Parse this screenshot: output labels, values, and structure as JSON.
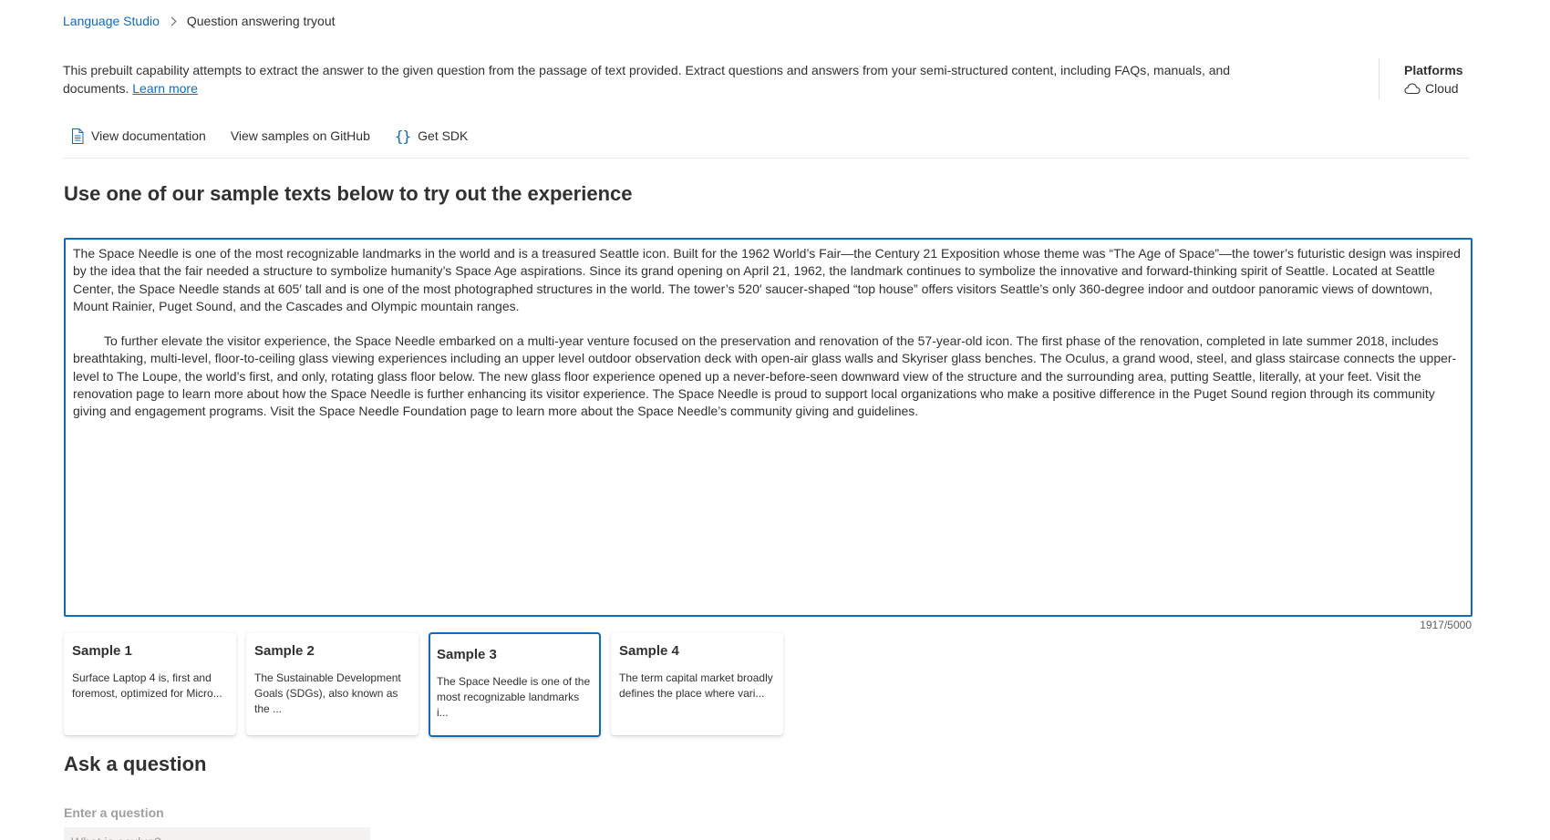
{
  "breadcrumb": {
    "root": "Language Studio",
    "current": "Question answering tryout"
  },
  "description": {
    "text": "This prebuilt capability attempts to extract the answer to the given question from the passage of text provided. Extract questions and answers from your semi-structured content, including FAQs, manuals, and documents.",
    "learn_more": "Learn more"
  },
  "platforms": {
    "title": "Platforms",
    "value": "Cloud",
    "icon": "cloud-icon"
  },
  "links": {
    "documentation": "View documentation",
    "github": "View samples on GitHub",
    "sdk": "Get SDK",
    "documentation_icon": "document-icon",
    "sdk_icon": "code-braces-icon"
  },
  "sample_section": {
    "title": "Use one of our sample texts below to try out the experience"
  },
  "passage": {
    "paragraph1": "The Space Needle is one of the most recognizable landmarks in the world and is a treasured Seattle icon. Built for the 1962 World’s Fair—the Century 21 Exposition whose theme was “The Age of Space”—the tower’s futuristic design was inspired by the idea that the fair needed a structure to symbolize humanity’s Space Age aspirations. Since its grand opening on April 21, 1962, the landmark continues to symbolize the innovative and forward-thinking spirit of Seattle. Located at Seattle Center, the Space Needle stands at 605′ tall and is one of the most photographed structures in the world. The tower’s 520′ saucer-shaped “top house” offers visitors Seattle’s only 360-degree indoor and outdoor panoramic views of downtown, Mount Rainier, Puget Sound, and the Cascades and Olympic mountain ranges.",
    "paragraph2": "To further elevate the visitor experience, the Space Needle embarked on a multi-year venture focused on the preservation and renovation of the 57-year-old icon. The first phase of the renovation, completed in late summer 2018, includes breathtaking, multi-level, floor-to-ceiling glass viewing experiences including an upper level outdoor observation deck with open-air glass walls and Skyriser glass benches. The Oculus, a grand wood, steel, and glass staircase connects the upper-level to The Loupe, the world’s first, and only, rotating glass floor below. The new glass floor experience opened up a never-before-seen downward view of the structure and the surrounding area, putting Seattle, literally, at your feet. Visit the renovation page to learn more about how the Space Needle is further enhancing its visitor experience. The Space Needle is proud to support local organizations who make a positive difference in the Puget Sound region through its community giving and engagement programs. Visit the Space Needle Foundation page to learn more about the Space Needle’s community giving and guidelines.",
    "char_count": "1917/5000"
  },
  "samples": [
    {
      "title": "Sample 1",
      "desc": "Surface Laptop 4 is, first and foremost, optimized for Micro...",
      "selected": false
    },
    {
      "title": "Sample 2",
      "desc": "The Sustainable Development Goals (SDGs), also known as the ...",
      "selected": false
    },
    {
      "title": "Sample 3",
      "desc": "The Space Needle is one of the most recognizable landmarks i...",
      "selected": true
    },
    {
      "title": "Sample 4",
      "desc": "The term capital market broadly defines the place where vari...",
      "selected": false
    }
  ],
  "ask": {
    "title": "Ask a question",
    "label": "Enter a question",
    "placeholder": "What is oculus?"
  },
  "colors": {
    "accent": "#0f6cbd",
    "text": "#323130",
    "muted": "#a19f9d"
  }
}
